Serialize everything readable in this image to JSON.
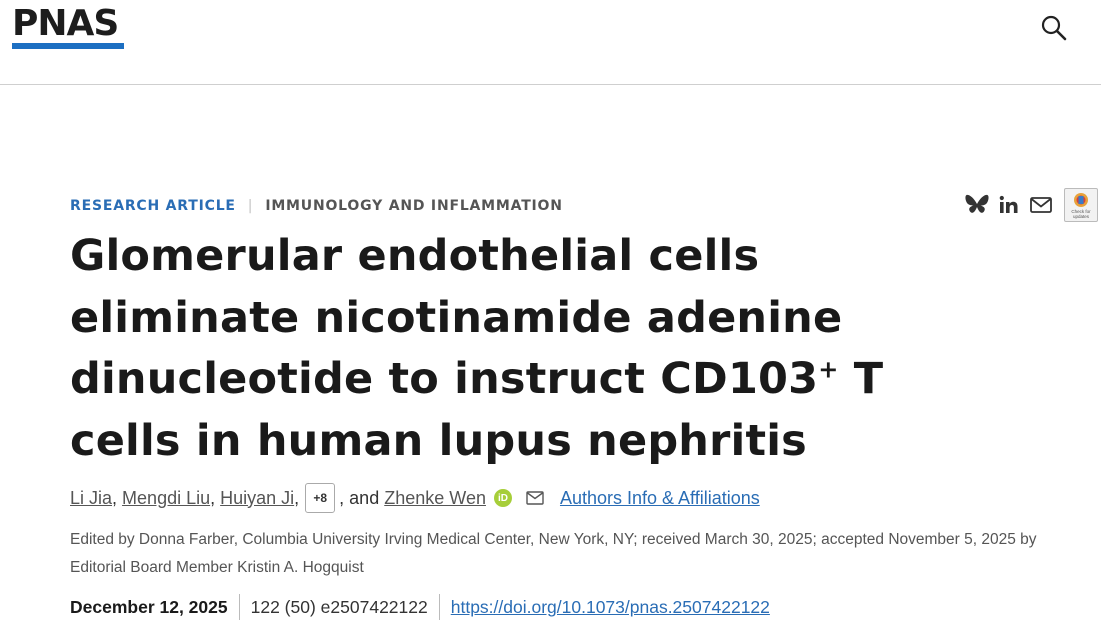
{
  "header": {
    "logo_text": "PNAS",
    "search_icon": "search-icon",
    "brand_color": "#1d6fc2"
  },
  "article": {
    "type_label": "RESEARCH ARTICLE",
    "topic_label": "IMMUNOLOGY AND INFLAMMATION",
    "title_part1": "Glomerular endothelial cells eliminate nicotinamide adenine dinucleotide to instruct CD103",
    "title_sup": "+",
    "title_part2": " T cells in human lupus nephritis",
    "authors": [
      "Li Jia",
      "Mengdi Liu",
      "Huiyan Ji"
    ],
    "more_authors_label": "+8",
    "and_text": ", and",
    "last_author": "Zhenke Wen",
    "affiliations_label": "Authors Info & Affiliations",
    "edited_text": "Edited by Donna Farber, Columbia University Irving Medical Center, New York, NY; received March 30, 2025; accepted November 5, 2025 by Editorial Board Member Kristin A. Hogquist",
    "date": "December 12, 2025",
    "volume_info": "122 (50) e2507422122",
    "doi": "https://doi.org/10.1073/pnas.2507422122"
  },
  "share": {
    "icons": [
      "bluesky-icon",
      "linkedin-icon",
      "email-icon",
      "check-for-updates-icon"
    ],
    "check_updates_label": "Check for updates"
  },
  "colors": {
    "link": "#2a6db5",
    "orcid": "#a6ce39"
  }
}
